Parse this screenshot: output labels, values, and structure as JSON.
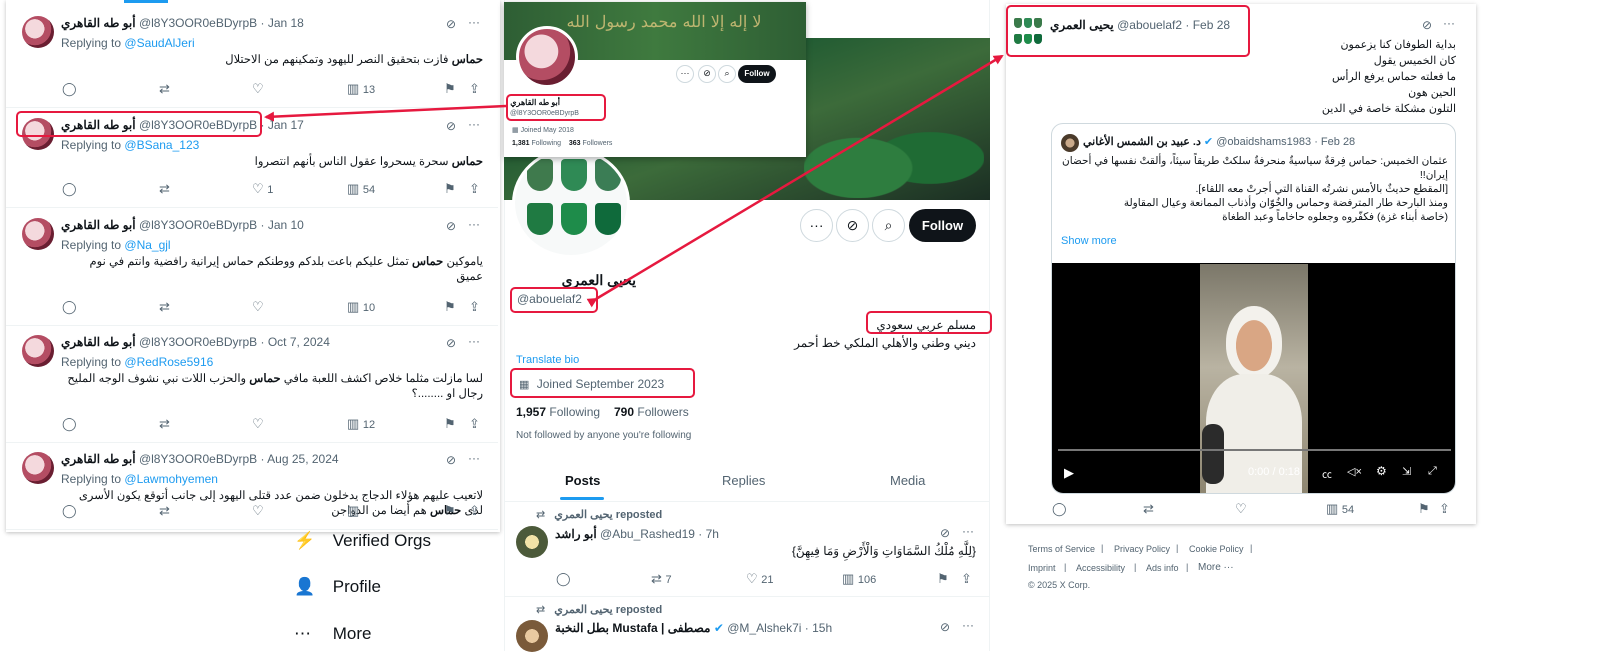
{
  "left_panel": {
    "tweets": [
      {
        "name": "أبو طه القاهري",
        "meta": "@l8Y3OOR0eBDyrpB · Jan 18",
        "reply_prefix": "Replying to",
        "reply_to": "@SaudAlJeri",
        "text_pre": "",
        "text_bold": "حماس",
        "text_post": " فازت بتحقيق النصر لليهود وتمكينهم من الاحتلال",
        "reply_count": "",
        "retweet_count": "",
        "like_count": "",
        "view_count": "13"
      },
      {
        "name": "أبو طه القاهري",
        "meta": "@l8Y3OOR0eBDyrpB · Jan 17",
        "reply_prefix": "Replying to",
        "reply_to": "@BSana_123",
        "text_pre": "",
        "text_bold": "حماس",
        "text_post": " سحرة يسحروا عقول الناس بأنهم انتصروا",
        "reply_count": "",
        "retweet_count": "",
        "like_count": "1",
        "view_count": "54"
      },
      {
        "name": "أبو طه القاهري",
        "meta": "@l8Y3OOR0eBDyrpB · Jan 10",
        "reply_prefix": "Replying to",
        "reply_to": "@Na_gjl",
        "text_pre": "ياموكين ",
        "text_bold": "حماس",
        "text_post": " تمثل عليكم باعت بلدكم ووطنكم حماس إيرانية رافضية وانتم في نوم عميق",
        "reply_count": "",
        "retweet_count": "",
        "like_count": "",
        "view_count": "10"
      },
      {
        "name": "أبو طه القاهري",
        "meta": "@l8Y3OOR0eBDyrpB · Oct 7, 2024",
        "reply_prefix": "Replying to",
        "reply_to": "@RedRose5916",
        "text_pre": "لسا مازلت مثلما خلاص اكشف اللعبة مافي ",
        "text_bold": "حماس",
        "text_post": " والحزب اللات نبي نشوف الوجه المليح رجال او ........؟",
        "reply_count": "",
        "retweet_count": "",
        "like_count": "",
        "view_count": "12"
      },
      {
        "name": "أبو طه القاهري",
        "meta": "@l8Y3OOR0eBDyrpB · Aug 25, 2024",
        "reply_prefix": "Replying to",
        "reply_to": "@Lawmohyemen",
        "text_pre": "لاتعيب عليهم هؤلاء الدجاج يدخلون ضمن عدد قتلى اليهود إلى جانب أتوقع يكون الأسرى لدى ",
        "text_bold": "حماس",
        "text_post": " هم أيضا من الدواجن",
        "reply_count": "",
        "retweet_count": "",
        "like_count": "",
        "view_count": ""
      }
    ]
  },
  "sidebar_nav": {
    "items": [
      {
        "label": "Verified Orgs",
        "icon": "lightning-icon"
      },
      {
        "label": "Profile",
        "icon": "person-icon"
      },
      {
        "label": "More",
        "icon": "more-circle-icon"
      }
    ]
  },
  "profile_card": {
    "name": "أبو طه القاهري",
    "handle": "@l8Y3OOR0eBDyrpB",
    "joined": "Joined May 2018",
    "following_count": "1,381",
    "following_label": "Following",
    "followers_count": "363",
    "followers_label": "Followers",
    "follow_label": "Follow",
    "banner_text": "لا إله إلا الله محمد رسول الله"
  },
  "profile": {
    "name": "يحيى العمري",
    "handle": "@abouelaf2",
    "bio_line1": "مسلم عربي سعودي",
    "bio_line2": "ديني وطني والأهلي الملكي خط أحمر",
    "translate_label": "Translate bio",
    "joined": "Joined September 2023",
    "following_count": "1,957",
    "following_label": "Following",
    "followers_count": "790",
    "followers_label": "Followers",
    "not_followed": "Not followed by anyone you're following",
    "follow_label": "Follow",
    "tabs": [
      "Posts",
      "Replies",
      "Media"
    ],
    "feed": [
      {
        "repost_label": "يحيى العمري reposted",
        "name": "أبو راشد",
        "meta": "@Abu_Rashed19 · 7h",
        "text": "{لِلَّهِ مُلْكُ السَّمَاوَاتِ وَالْأَرْضِ وَمَا فِيهِنَّ}",
        "retweet_count": "7",
        "like_count": "21",
        "view_count": "106"
      },
      {
        "repost_label": "يحيى العمري reposted",
        "name": "بطل النخبة Mustafa | مصطفى",
        "meta": "@M_Alshek7i · 15h"
      }
    ]
  },
  "right_tweet": {
    "name": "يحيى العمري",
    "meta": "@abouelaf2 · Feb 28",
    "lines": [
      "بداية الطوفان كنا يزعمون",
      "كان الخميس يقول",
      "ما فعلته حماس يرفع الرأس",
      "الحين هون",
      "التلون مشكلة خاصة في الدين"
    ],
    "bold_word": "حماس",
    "quote": {
      "name": "د. عبيد بن الشمس الأغاني",
      "meta": "@obaidshams1983 · Feb 28",
      "lines": [
        "عثمان الخميس: حماس فِرقةٌ سياسيةٌ منحرفةٌ سلكتْ طريقاً سيئاً، وألقتْ نفسها في أحضان إيران!!",
        "[المقطع حديثٌ بالأمس نشرتُه القناة التي أجرتْ معه اللقاء].",
        "ومنذ البارحة طار المترفضة وحماس والخُوّان وأذناب الممانعة وعيال المقاولة",
        "(خاصة أبناء غزة) فكفّروه وجعلوه حاخاماً وعبد الطغاة"
      ],
      "show_more": "Show more",
      "video_time": "0:00 / 0:18"
    },
    "view_count": "54",
    "footer_links": [
      "Terms of Service",
      "Privacy Policy",
      "Cookie Policy",
      "Imprint",
      "Accessibility",
      "Ads info",
      "More ···"
    ],
    "copyright": "© 2025 X Corp."
  },
  "colors": {
    "accent": "#1d9bf0",
    "highlight": "#e6193f",
    "text": "#0f1419",
    "muted": "#536471"
  }
}
